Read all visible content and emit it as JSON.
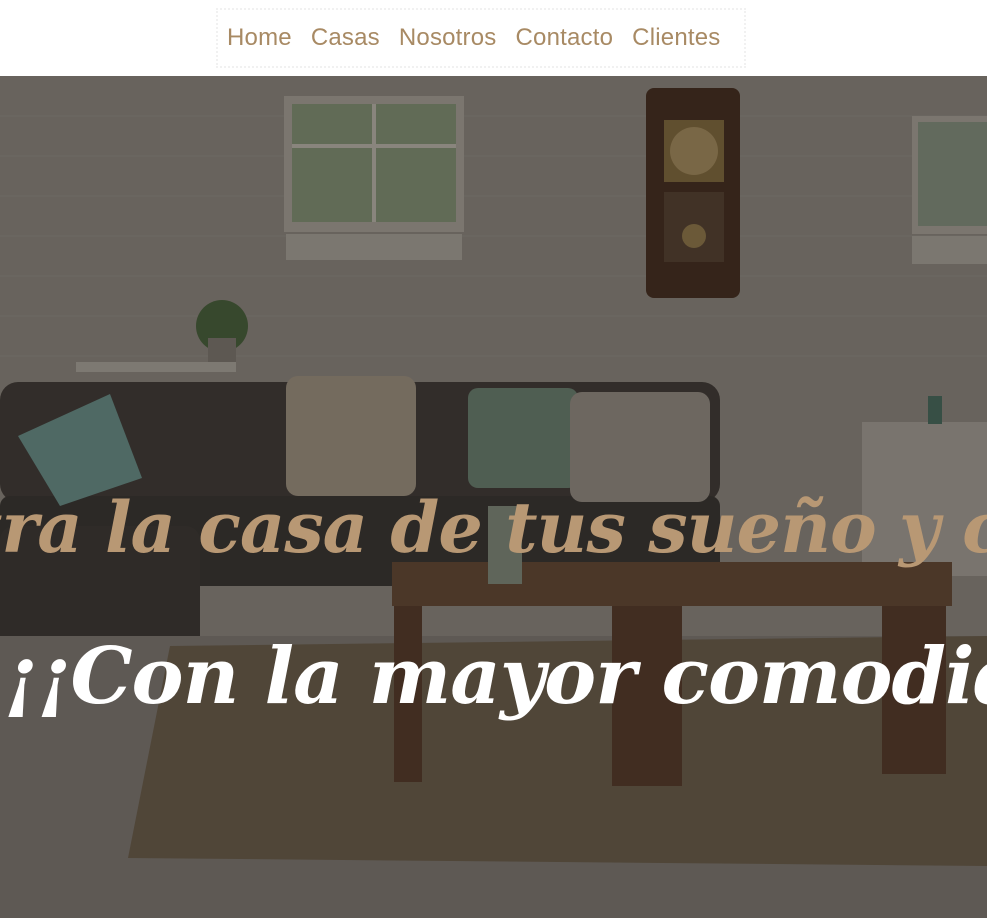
{
  "nav": {
    "items": [
      {
        "label": "Home"
      },
      {
        "label": "Casas"
      },
      {
        "label": "Nosotros"
      },
      {
        "label": "Contacto"
      },
      {
        "label": "Clientes"
      }
    ]
  },
  "hero": {
    "headline": "tra la casa de tus sueño y co",
    "subline": "¡¡Con la mayor comodidad"
  },
  "colors": {
    "nav_text": "#a88a64",
    "headline_text": "#b89874",
    "subline_text": "#ffffff",
    "overlay": "#000000"
  }
}
